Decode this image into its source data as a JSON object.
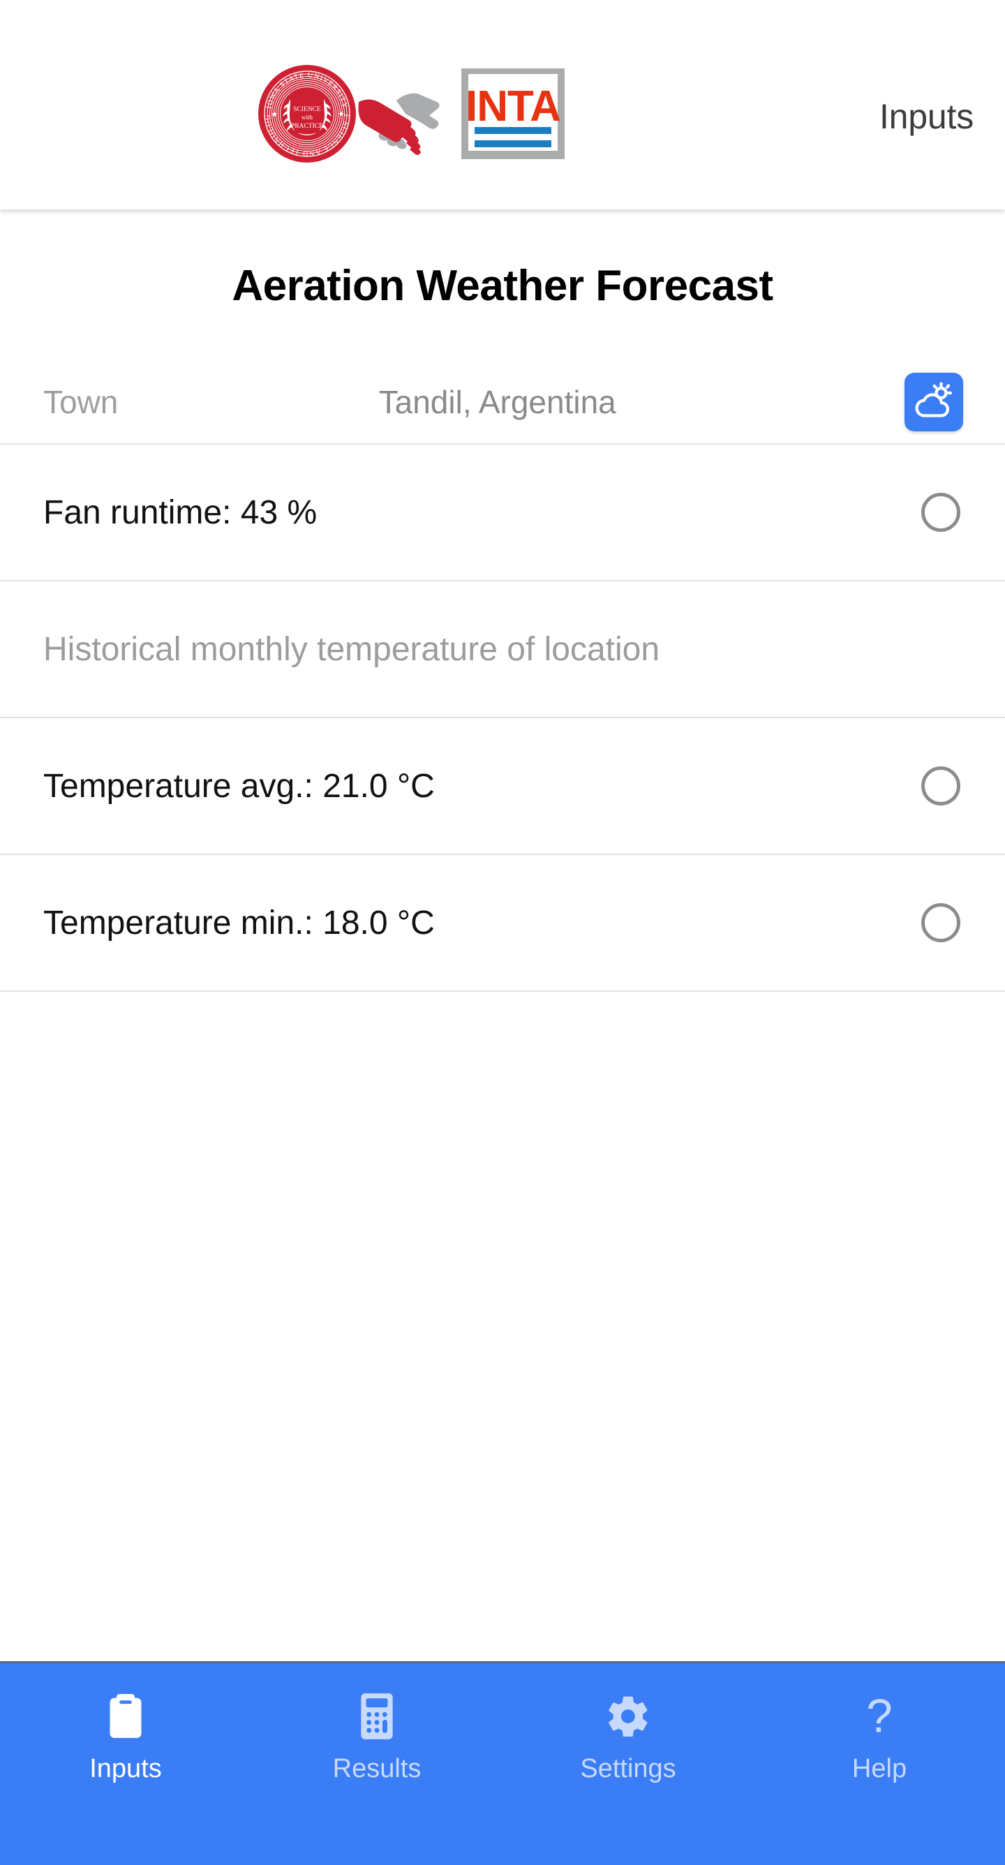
{
  "appbar": {
    "title": "Inputs",
    "logo": {
      "name": "isu-inta-partnership-logo",
      "seal_text_top": "IOWA STATE UNIVERSITY",
      "seal_text_bottom": "OF SCIENCE AND TECHNOLOGY",
      "seal_center_line1": "SCIENCE",
      "seal_center_line2": "with",
      "seal_center_line3": "PRACTICE",
      "partner_text": "INTA",
      "seal_color": "#CE2033",
      "handshake_gray": "#A9ABAD",
      "inta_red": "#E63312",
      "inta_blue": "#1A7FC1"
    }
  },
  "main": {
    "page_title": "Aeration Weather Forecast",
    "town_row": {
      "label": "Town",
      "value": "Tandil, Argentina",
      "button_icon": "partly-cloudy-icon",
      "button_color": "#3b7df5"
    },
    "rows": [
      {
        "name": "fan-runtime",
        "text": "Fan runtime: 43 %",
        "muted": false,
        "indicator": "circle-unselected"
      },
      {
        "name": "historical-monthly-temperature",
        "text": "Historical monthly temperature of location",
        "muted": true,
        "indicator": "none"
      },
      {
        "name": "temperature-avg",
        "text": "Temperature avg.: 21.0 °C",
        "muted": false,
        "indicator": "circle-unselected"
      },
      {
        "name": "temperature-min",
        "text": "Temperature min.: 18.0 °C",
        "muted": false,
        "indicator": "circle-unselected"
      }
    ]
  },
  "bottomnav": {
    "background": "#3b7df5",
    "active_index": 0,
    "items": [
      {
        "label": "Inputs",
        "icon": "clipboard-icon"
      },
      {
        "label": "Results",
        "icon": "calculator-icon"
      },
      {
        "label": "Settings",
        "icon": "gear-icon"
      },
      {
        "label": "Help",
        "icon": "question-mark-icon"
      }
    ]
  }
}
